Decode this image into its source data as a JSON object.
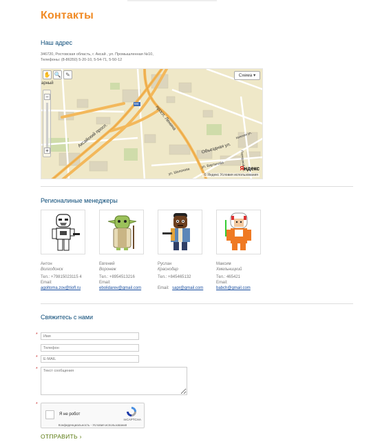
{
  "page": {
    "title": "Контакты"
  },
  "address": {
    "title": "Наш адрес",
    "line1": "346720, Ростовская область, г. Аксай , ул. Промышленная №10,",
    "line2": "Телефоны: (8-86350) 5-20-10, 5-54-71, 5-50-12"
  },
  "map": {
    "scheme_label": "Схема ▾",
    "left_label": "арный",
    "zoom_in": "+",
    "zoom_out": "−",
    "yandex_y": "Я",
    "yandex_rest": "ндекс",
    "copyright": "© Яндекс  Условия использования",
    "roads": {
      "aksai": "Аксайский просп.",
      "lenina": "просп. Ленина",
      "obezdnoy": "Объездная ул.",
      "vartanova": "ул. Вартанова",
      "sholokhova": "ул. Шолохова",
      "m4": "M4",
      "kilpskaya": "Кипская ул.",
      "peredovoy": "Передовой пр."
    },
    "colors": {
      "land": "#efe8c8",
      "highway": "#f3b85b",
      "road": "#ffffff",
      "green": "#cfdcaa",
      "building": "#dcd5bd"
    }
  },
  "managers": {
    "title": "Регионалиные менеджеры",
    "items": [
      {
        "name": "Антон",
        "city": "Волгодонск",
        "tel": "Тел.: +79815023115 4",
        "email_label": "Email:",
        "email": "agoltoma.zov@tiofl.ru",
        "avatar_icon": "stormtrooper-icon"
      },
      {
        "name": "Евгений",
        "city": "Воронеж",
        "tel": "Тел.: +8954513216",
        "email_label": "Email:",
        "email": "ebolidarev@gmail.com",
        "avatar_icon": "yoda-icon"
      },
      {
        "name": "Руслан",
        "city": "Краснодар",
        "tel": "Тел.: +845465132",
        "email_label": "Email:",
        "email": "sapr@gmail.com",
        "avatar_icon": "lando-icon"
      },
      {
        "name": "Максим",
        "city": "Хмельницкий",
        "tel": "Тел.: 465421",
        "email_label": "Email:",
        "email": "babch@gmail.com",
        "avatar_icon": "pilot-icon"
      }
    ]
  },
  "contact": {
    "title": "Свяжитесь с нами",
    "required_mark": "*",
    "name_placeholder": "Имя",
    "phone_placeholder": "Телефон",
    "email_placeholder": "E-MAIL",
    "message_placeholder": "Текст сообщения",
    "captcha_text": "Я не робот",
    "captcha_brand": "reCAPTCHA",
    "captcha_links": "Конфиденциальность - Условия использования",
    "submit_label": "ОТПРАВИТЬ ›"
  }
}
